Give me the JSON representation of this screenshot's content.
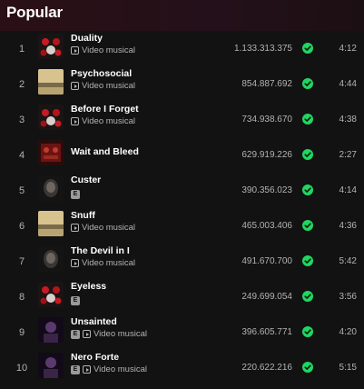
{
  "section": {
    "title": "Popular"
  },
  "tracks": [
    {
      "rank": "1",
      "title": "Duality",
      "explicit": false,
      "video": true,
      "video_label": "Video musical",
      "plays": "1.133.313.375",
      "saved": true,
      "duration": "4:12",
      "art": "masks"
    },
    {
      "rank": "2",
      "title": "Psychosocial",
      "explicit": false,
      "video": true,
      "video_label": "Video musical",
      "plays": "854.887.692",
      "saved": true,
      "duration": "4:44",
      "art": "beige"
    },
    {
      "rank": "3",
      "title": "Before I Forget",
      "explicit": false,
      "video": true,
      "video_label": "Video musical",
      "plays": "734.938.670",
      "saved": true,
      "duration": "4:38",
      "art": "masks"
    },
    {
      "rank": "4",
      "title": "Wait and Bleed",
      "explicit": false,
      "video": false,
      "video_label": "",
      "plays": "629.919.226",
      "saved": true,
      "duration": "2:27",
      "art": "red"
    },
    {
      "rank": "5",
      "title": "Custer",
      "explicit": true,
      "video": false,
      "video_label": "",
      "plays": "390.356.023",
      "saved": true,
      "duration": "4:14",
      "art": "dark"
    },
    {
      "rank": "6",
      "title": "Snuff",
      "explicit": false,
      "video": true,
      "video_label": "Video musical",
      "plays": "465.003.406",
      "saved": true,
      "duration": "4:36",
      "art": "beige"
    },
    {
      "rank": "7",
      "title": "The Devil in I",
      "explicit": false,
      "video": true,
      "video_label": "Video musical",
      "plays": "491.670.700",
      "saved": true,
      "duration": "5:42",
      "art": "dark"
    },
    {
      "rank": "8",
      "title": "Eyeless",
      "explicit": true,
      "video": false,
      "video_label": "",
      "plays": "249.699.054",
      "saved": true,
      "duration": "3:56",
      "art": "masks"
    },
    {
      "rank": "9",
      "title": "Unsainted",
      "explicit": true,
      "video": true,
      "video_label": "Video musical",
      "plays": "396.605.771",
      "saved": true,
      "duration": "4:20",
      "art": "purple"
    },
    {
      "rank": "10",
      "title": "Nero Forte",
      "explicit": true,
      "video": true,
      "video_label": "Video musical",
      "plays": "220.622.216",
      "saved": true,
      "duration": "5:15",
      "art": "purple"
    }
  ],
  "labels": {
    "explicit_badge": "E"
  },
  "colors": {
    "accent": "#1ed760",
    "background": "#121212",
    "muted_text": "#b3b3b3"
  }
}
